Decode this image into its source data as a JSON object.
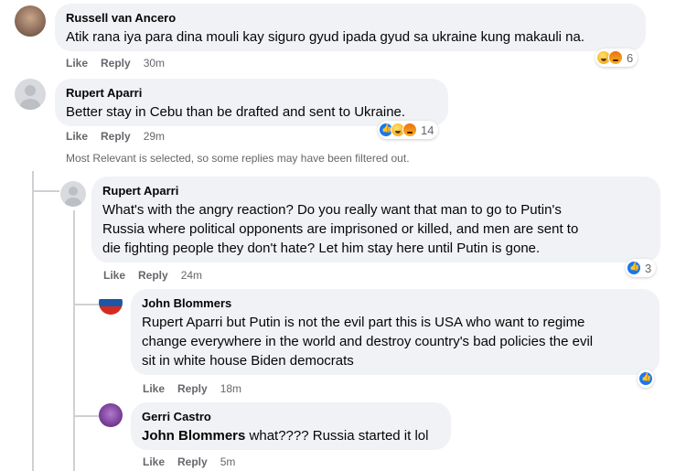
{
  "comments": [
    {
      "author": "Russell van Ancero",
      "text": "Atik rana iya para dina mouli kay siguro gyud ipada gyud sa ukraine kung makauli na.",
      "like": "Like",
      "reply": "Reply",
      "time": "30m",
      "reaction_count": "6",
      "reactions": [
        "haha-icon",
        "angry-icon"
      ]
    },
    {
      "author": "Rupert Aparri",
      "text": "Better stay in Cebu than be drafted and sent to Ukraine.",
      "like": "Like",
      "reply": "Reply",
      "time": "29m",
      "reaction_count": "14",
      "reactions": [
        "like-icon",
        "haha-icon",
        "angry-icon"
      ]
    }
  ],
  "filter_notice": "Most Relevant is selected, so some replies may have been filtered out.",
  "replies": [
    {
      "author": "Rupert Aparri",
      "lines": [
        "What's with the angry reaction? Do you really want that man to go to Putin's",
        "Russia where political opponents are imprisoned or killed, and men are sent to",
        "die fighting people they don't hate? Let him stay here until Putin is gone."
      ],
      "like": "Like",
      "reply": "Reply",
      "time": "24m",
      "reaction_count": "3"
    },
    {
      "author": "John Blommers",
      "lines": [
        "Rupert Aparri but Putin is not the evil part this is USA who want to regime",
        "change everywhere in the world and destroy country's bad policies the evil",
        "sit in white house Biden democrats"
      ],
      "like": "Like",
      "reply": "Reply",
      "time": "18m"
    },
    {
      "author": "Gerri Castro",
      "mention": "John Blommers",
      "text": "what???? Russia started it lol",
      "like": "Like",
      "reply": "Reply",
      "time": "5m"
    }
  ]
}
